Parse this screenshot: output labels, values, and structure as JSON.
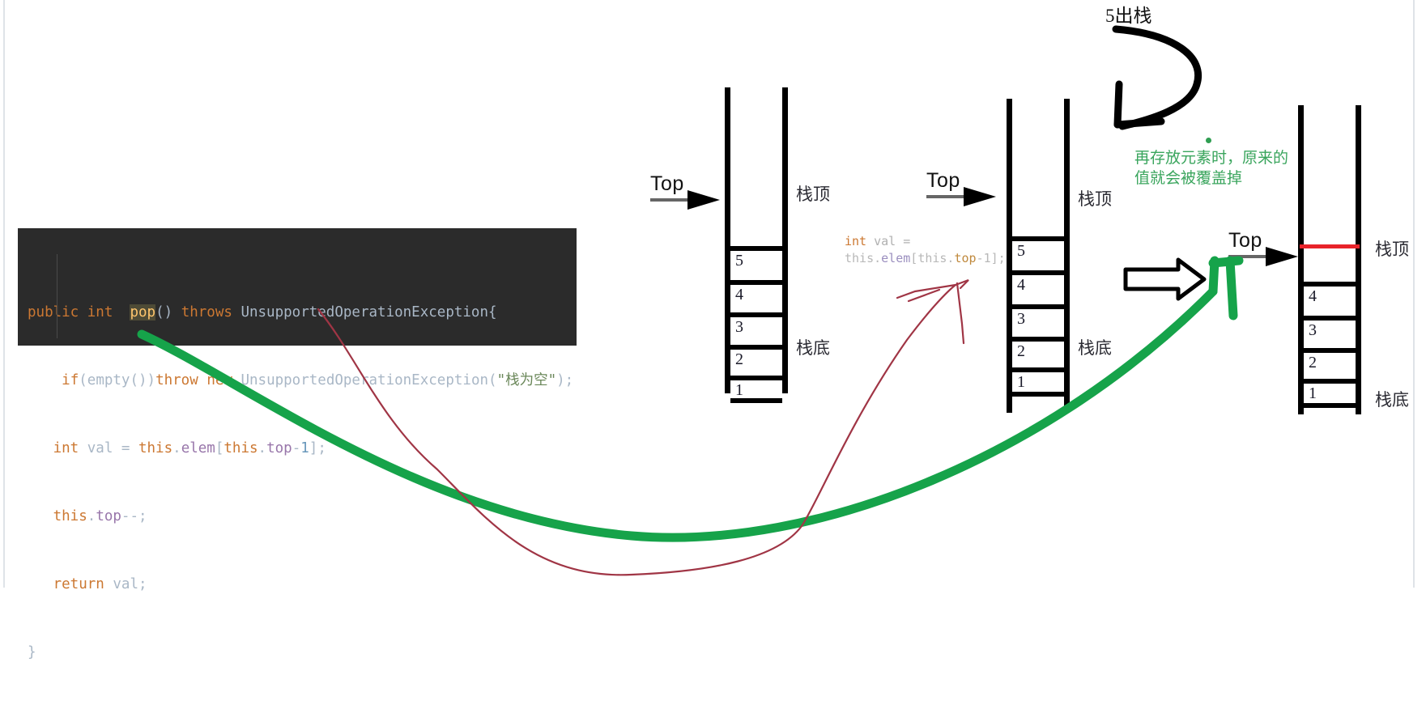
{
  "code_block": {
    "language": "java",
    "lines": [
      [
        {
          "t": "public",
          "c": "k"
        },
        {
          "t": " ",
          "c": "pl"
        },
        {
          "t": "int",
          "c": "k"
        },
        {
          "t": "  ",
          "c": "pl"
        },
        {
          "t": "pop",
          "c": "fn hl"
        },
        {
          "t": "()",
          "c": "pl"
        },
        {
          "t": " ",
          "c": "pl"
        },
        {
          "t": "throws",
          "c": "k"
        },
        {
          "t": " ",
          "c": "pl"
        },
        {
          "t": "UnsupportedOperationException",
          "c": "cls"
        },
        {
          "t": "{",
          "c": "pl"
        }
      ],
      [
        {
          "t": "    ",
          "c": "pl"
        },
        {
          "t": "if",
          "c": "k"
        },
        {
          "t": "(",
          "c": "pl"
        },
        {
          "t": "empty",
          "c": "pl"
        },
        {
          "t": "())",
          "c": "pl"
        },
        {
          "t": "throw",
          "c": "k"
        },
        {
          "t": " ",
          "c": "pl"
        },
        {
          "t": "new",
          "c": "k"
        },
        {
          "t": " ",
          "c": "pl"
        },
        {
          "t": "UnsupportedOperationException",
          "c": "cls"
        },
        {
          "t": "(",
          "c": "pl"
        },
        {
          "t": "\"栈为空\"",
          "c": "str"
        },
        {
          "t": ");",
          "c": "pl"
        }
      ],
      [
        {
          "t": "   ",
          "c": "pl"
        },
        {
          "t": "int",
          "c": "k"
        },
        {
          "t": " ",
          "c": "pl"
        },
        {
          "t": "val",
          "c": "pl"
        },
        {
          "t": " = ",
          "c": "pl"
        },
        {
          "t": "this",
          "c": "k"
        },
        {
          "t": ".",
          "c": "pl"
        },
        {
          "t": "elem",
          "c": "fld"
        },
        {
          "t": "[",
          "c": "pl"
        },
        {
          "t": "this",
          "c": "k"
        },
        {
          "t": ".",
          "c": "pl"
        },
        {
          "t": "top",
          "c": "fld"
        },
        {
          "t": "-",
          "c": "pl"
        },
        {
          "t": "1",
          "c": "num"
        },
        {
          "t": "];",
          "c": "pl"
        }
      ],
      [
        {
          "t": "   ",
          "c": "pl"
        },
        {
          "t": "this",
          "c": "k"
        },
        {
          "t": ".",
          "c": "pl"
        },
        {
          "t": "top",
          "c": "fld"
        },
        {
          "t": "--;",
          "c": "pl"
        }
      ],
      [
        {
          "t": "   ",
          "c": "pl"
        },
        {
          "t": "return",
          "c": "k"
        },
        {
          "t": " ",
          "c": "pl"
        },
        {
          "t": "val",
          "c": "pl"
        },
        {
          "t": ";",
          "c": "pl"
        }
      ],
      [
        {
          "t": "}",
          "c": "pl"
        }
      ]
    ]
  },
  "inline_code_note": {
    "line1": "int val =",
    "line2": "this.elem[this.top-1];"
  },
  "annotations": {
    "pop_label": "5出栈",
    "green_note_line1": "再存放元素时，原来的",
    "green_note_line2": "值就会被覆盖掉"
  },
  "stacks": [
    {
      "id": "stack-before",
      "top_arrow_label": "Top",
      "cells": [
        "5",
        "4",
        "3",
        "2",
        "1"
      ],
      "top_label": "栈顶",
      "bottom_label": "栈底",
      "has_red_line": false
    },
    {
      "id": "stack-reading",
      "top_arrow_label": "Top",
      "cells": [
        "5",
        "4",
        "3",
        "2",
        "1"
      ],
      "top_label": "栈顶",
      "bottom_label": "栈底",
      "has_red_line": false
    },
    {
      "id": "stack-after",
      "top_arrow_label": "Top",
      "cells": [
        "4",
        "3",
        "2",
        "1"
      ],
      "top_label": "栈顶",
      "bottom_label": "栈底",
      "has_red_line": true
    }
  ],
  "colors": {
    "code_bg": "#2b2b2b",
    "keyword": "#cc7832",
    "method": "#ffc66d",
    "field": "#9876aa",
    "string": "#6a8759",
    "plain": "#a9b7c6",
    "number": "#6897bb",
    "green_note": "#3aa55d",
    "green_arrow": "#16a34a",
    "red_line": "#e8232a",
    "red_scribble": "#a03545",
    "stack_stroke": "#000000"
  }
}
